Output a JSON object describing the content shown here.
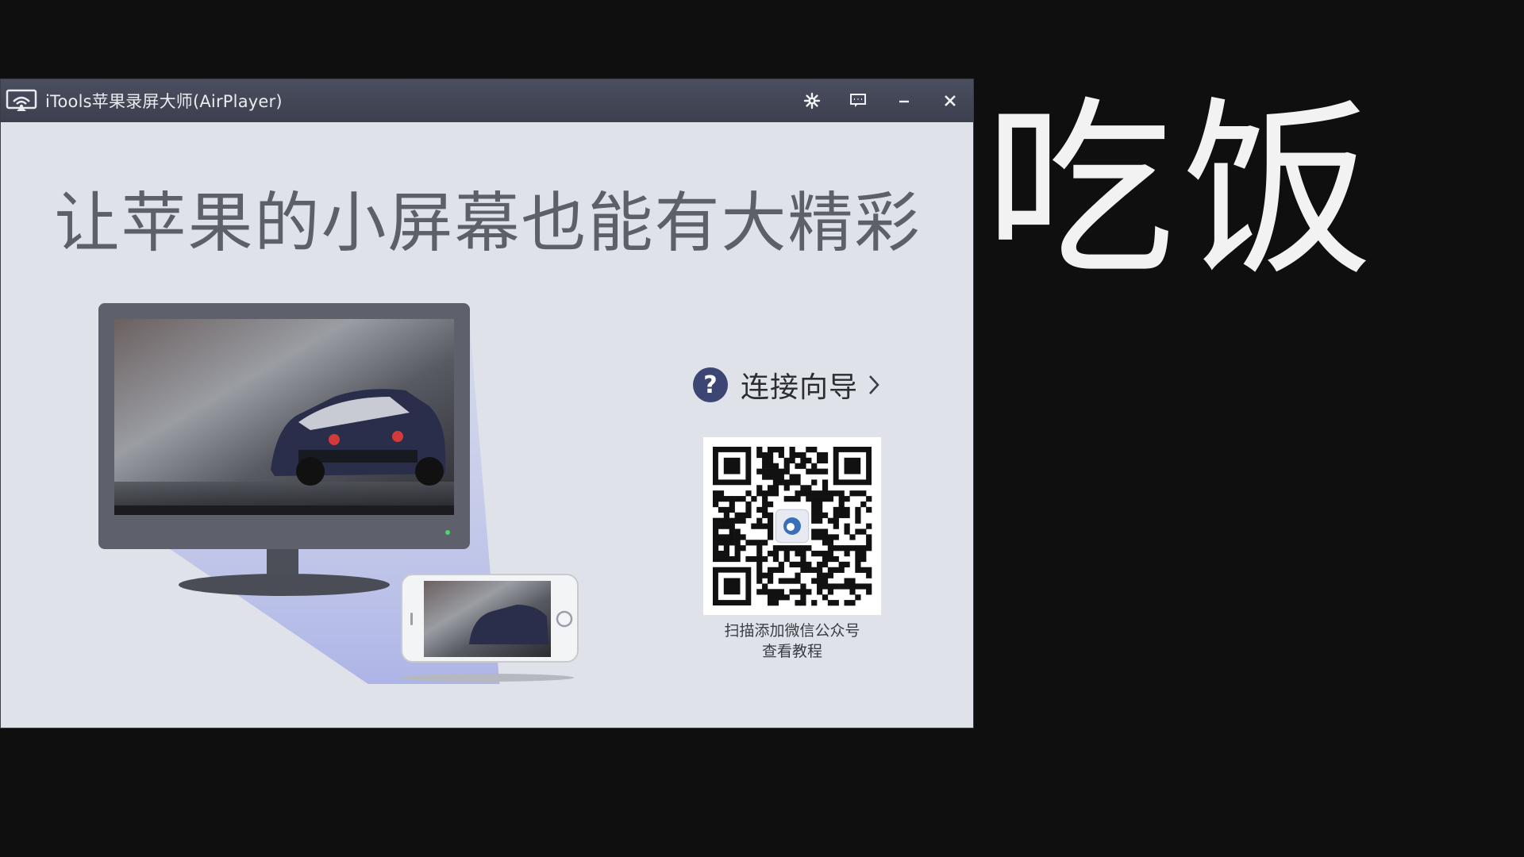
{
  "window": {
    "title": "iTools苹果录屏大师(AirPlayer)",
    "icon": "airplay-wifi-icon",
    "controls": [
      {
        "name": "settings-button",
        "icon": "gear-icon"
      },
      {
        "name": "feedback-button",
        "icon": "message-icon"
      },
      {
        "name": "minimize-button",
        "icon": "minimize-icon"
      },
      {
        "name": "close-button",
        "icon": "close-icon"
      }
    ]
  },
  "main": {
    "headline": "让苹果的小屏幕也能有大精彩",
    "guide_label": "连接向导",
    "help_glyph": "?",
    "qr_caption_line1": "扫描添加微信公众号",
    "qr_caption_line2": "查看教程"
  },
  "overlay": {
    "side_text": "吃饭"
  },
  "colors": {
    "titlebar": "#3f4352",
    "content_bg": "#dfe2e8",
    "accent": "#3d4575",
    "page_bg": "#0f0f10"
  }
}
